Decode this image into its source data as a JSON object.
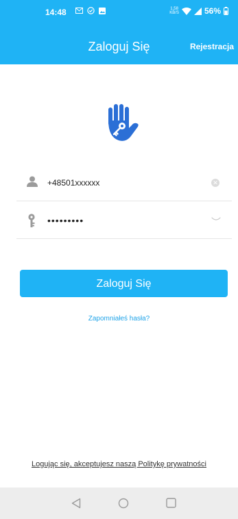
{
  "status_bar": {
    "time": "14:48",
    "net_speed_value": "1,58",
    "net_speed_unit": "KB/S",
    "battery": "56%"
  },
  "header": {
    "title": "Zaloguj Się",
    "register_label": "Rejestracja"
  },
  "form": {
    "phone_value": "+48501xxxxxx",
    "password_value": "•••••••••"
  },
  "actions": {
    "login_label": "Zaloguj Się",
    "forgot_label": "Zapomniałeś hasła?"
  },
  "footer": {
    "privacy_text": "Logując się, akceptujesz naszą Politykę prywatności"
  },
  "colors": {
    "accent": "#1fb3f5",
    "logo": "#2b6fd6",
    "link": "#1fa3e8"
  },
  "icons": {
    "logo": "hand-key-icon",
    "phone_field": "user-icon",
    "password_field": "key-icon"
  }
}
